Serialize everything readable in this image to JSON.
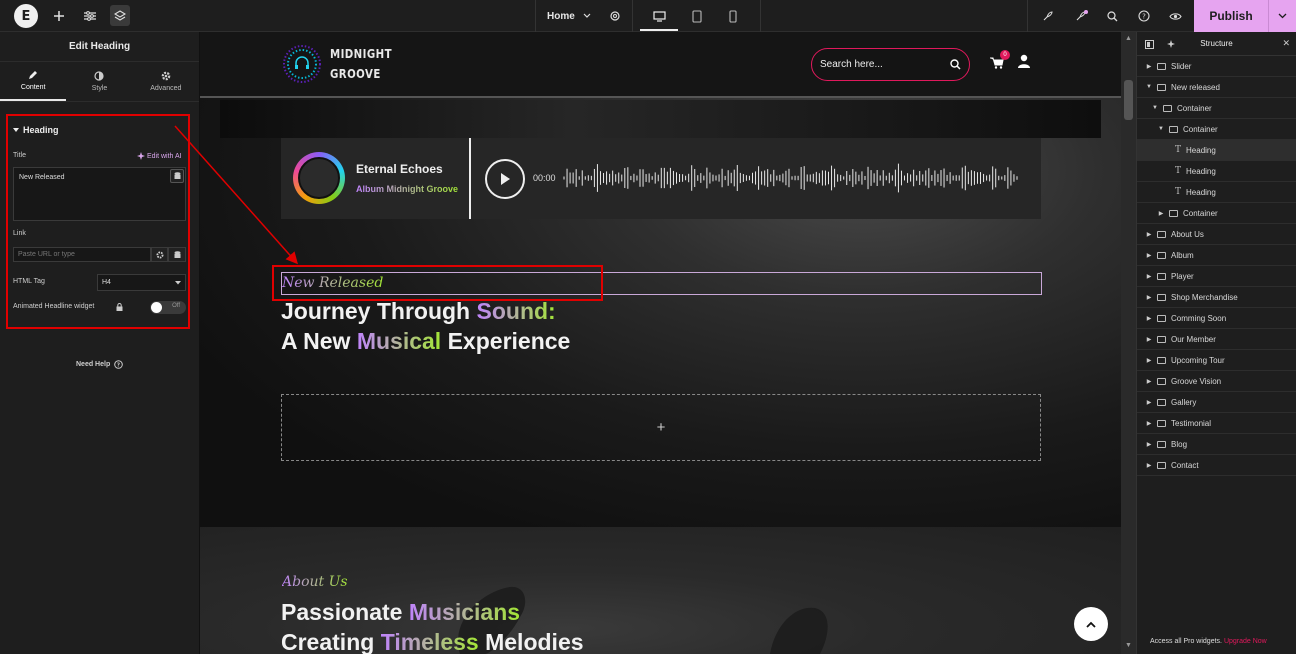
{
  "topbar": {
    "page_name": "Home",
    "publish_label": "Publish"
  },
  "left_panel": {
    "title": "Edit Heading",
    "tabs": [
      {
        "label": "Content",
        "icon": "pencil-icon"
      },
      {
        "label": "Style",
        "icon": "half-circle-icon"
      },
      {
        "label": "Advanced",
        "icon": "gear-icon"
      }
    ],
    "section_title": "Heading",
    "title_label": "Title",
    "edit_ai_label": "Edit with AI",
    "title_value": "New Released",
    "link_label": "Link",
    "link_placeholder": "Paste URL or type",
    "html_tag_label": "HTML Tag",
    "html_tag_value": "H4",
    "animated_label": "Animated Headline widget",
    "toggle_text": "Off",
    "need_help": "Need Help"
  },
  "site": {
    "brand_line1": "MIDNIGHT",
    "brand_line2": "GROOVE",
    "search_placeholder": "Search here...",
    "cart_count": "0",
    "player": {
      "track": "Eternal Echoes",
      "album": "Album Midnight Groove",
      "time": "00:00"
    },
    "hero": {
      "subheading": "New Released",
      "line1_a": "Journey Through ",
      "line1_b": "Sound:",
      "line2_a": "A New ",
      "line2_b": "Musical",
      "line2_c": " Experience"
    },
    "drop_plus": "+",
    "about": {
      "subheading": "About Us",
      "line1_a": "Passionate ",
      "line1_b": "Musicians",
      "line2_a": "Creating ",
      "line2_b": "Timeless",
      "line2_c": " Melodies"
    }
  },
  "structure": {
    "title": "Structure",
    "items": [
      {
        "label": "Slider",
        "indent": 0,
        "type": "container",
        "caret": "right"
      },
      {
        "label": "New released",
        "indent": 0,
        "type": "container",
        "caret": "down"
      },
      {
        "label": "Container",
        "indent": 1,
        "type": "container",
        "caret": "down"
      },
      {
        "label": "Container",
        "indent": 2,
        "type": "container",
        "caret": "down"
      },
      {
        "label": "Heading",
        "indent": 3,
        "type": "heading",
        "caret": "none",
        "selected": true
      },
      {
        "label": "Heading",
        "indent": 3,
        "type": "heading",
        "caret": "none"
      },
      {
        "label": "Heading",
        "indent": 3,
        "type": "heading",
        "caret": "none"
      },
      {
        "label": "Container",
        "indent": 2,
        "type": "container",
        "caret": "right"
      },
      {
        "label": "About Us",
        "indent": 0,
        "type": "container",
        "caret": "right"
      },
      {
        "label": "Album",
        "indent": 0,
        "type": "container",
        "caret": "right"
      },
      {
        "label": "Player",
        "indent": 0,
        "type": "container",
        "caret": "right"
      },
      {
        "label": "Shop Merchandise",
        "indent": 0,
        "type": "container",
        "caret": "right"
      },
      {
        "label": "Comming Soon",
        "indent": 0,
        "type": "container",
        "caret": "right"
      },
      {
        "label": "Our Member",
        "indent": 0,
        "type": "container",
        "caret": "right"
      },
      {
        "label": "Upcoming Tour",
        "indent": 0,
        "type": "container",
        "caret": "right"
      },
      {
        "label": "Groove Vision",
        "indent": 0,
        "type": "container",
        "caret": "right"
      },
      {
        "label": "Gallery",
        "indent": 0,
        "type": "container",
        "caret": "right"
      },
      {
        "label": "Testimonial",
        "indent": 0,
        "type": "container",
        "caret": "right"
      },
      {
        "label": "Blog",
        "indent": 0,
        "type": "container",
        "caret": "right"
      },
      {
        "label": "Contact",
        "indent": 0,
        "type": "container",
        "caret": "right"
      }
    ],
    "upgrade_text": "Access all Pro widgets.",
    "upgrade_link": "Upgrade Now"
  },
  "colors": {
    "accent": "#e6a4f0",
    "highlight": "#e00000",
    "brand_pink": "#e0195c"
  }
}
